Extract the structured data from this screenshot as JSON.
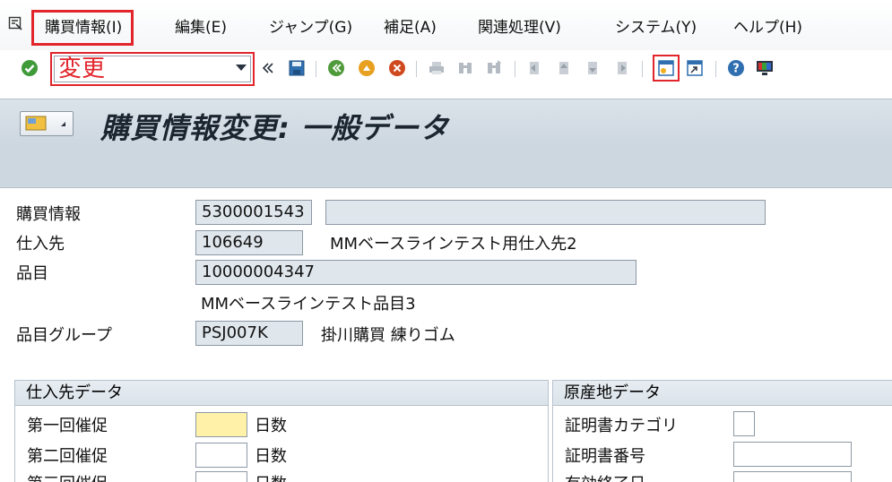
{
  "menu": {
    "items": [
      "購買情報(I)",
      "編集(E)",
      "ジャンプ(G)",
      "補足(A)",
      "関連処理(V)",
      "システム(Y)",
      "ヘルプ(H)"
    ]
  },
  "toolbar": {
    "command_value": "変更",
    "icons": [
      "check-icon",
      "double-left-icon",
      "save-icon",
      "back-icon",
      "exit-icon",
      "cancel-icon",
      "print-icon",
      "find-icon",
      "find-next-icon",
      "first-page-icon",
      "previous-page-icon",
      "next-page-icon",
      "last-page-icon",
      "create-session-icon",
      "shortcut-icon",
      "help-icon",
      "customize-layout-icon"
    ]
  },
  "title": {
    "text": "購買情報変更: 一般データ"
  },
  "form": {
    "info_record_label": "購買情報",
    "info_record_value": "5300001543",
    "info_record_desc": "",
    "vendor_label": "仕入先",
    "vendor_value": "106649",
    "vendor_name": "MMベースラインテスト用仕入先2",
    "material_label": "品目",
    "material_value": "10000004347",
    "material_desc": "MMベースラインテスト品目3",
    "material_group_label": "品目グループ",
    "material_group_value": "PSJ007K",
    "material_group_desc": "掛川購買 練りゴム"
  },
  "vendor_data": {
    "header": "仕入先データ",
    "rows": [
      {
        "label": "第一回催促",
        "value": "",
        "unit": "日数"
      },
      {
        "label": "第二回催促",
        "value": "",
        "unit": "日数"
      },
      {
        "label": "第三回催促",
        "value": "",
        "unit": "日数"
      }
    ]
  },
  "origin_data": {
    "header": "原産地データ",
    "rows": [
      {
        "label": "証明書カテゴリ",
        "value": ""
      },
      {
        "label": "証明書番号",
        "value": ""
      },
      {
        "label": "有効終了日",
        "value": ""
      }
    ]
  }
}
